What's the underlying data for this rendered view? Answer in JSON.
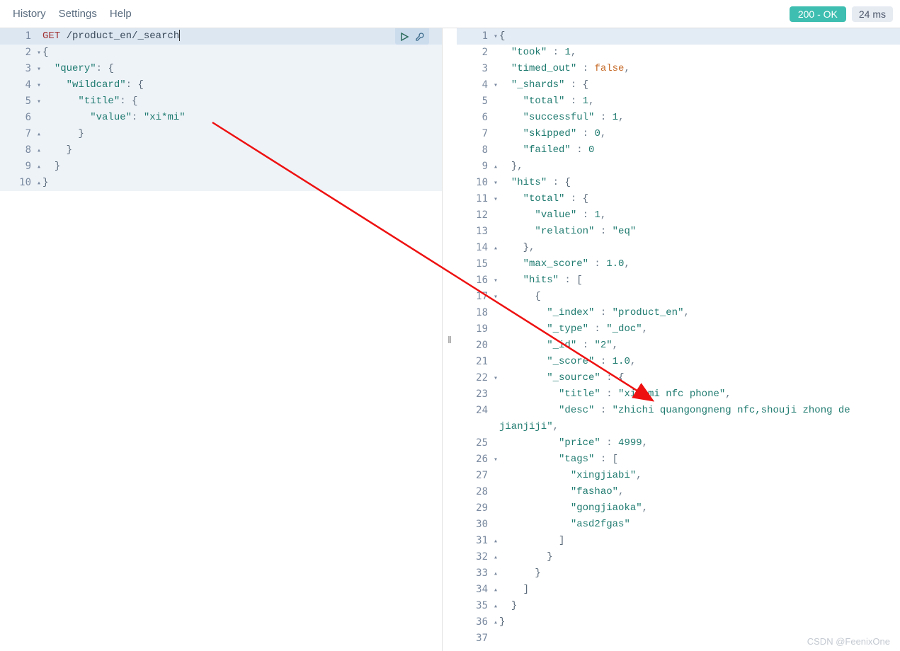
{
  "menu": {
    "history": "History",
    "settings": "Settings",
    "help": "Help"
  },
  "status": {
    "code_label": "200 - OK",
    "timing": "24 ms"
  },
  "request": {
    "method": "GET",
    "path": "/product_en/_search",
    "lines": [
      {
        "n": 1,
        "fold": ""
      },
      {
        "n": 2,
        "fold": "▾",
        "t": "{"
      },
      {
        "n": 3,
        "fold": "▾"
      },
      {
        "n": 4,
        "fold": "▾"
      },
      {
        "n": 5,
        "fold": "▾"
      },
      {
        "n": 6,
        "fold": ""
      },
      {
        "n": 7,
        "fold": "▴"
      },
      {
        "n": 8,
        "fold": "▴"
      },
      {
        "n": 9,
        "fold": "▴"
      },
      {
        "n": 10,
        "fold": "▴",
        "t": "}"
      }
    ],
    "keys": {
      "query": "\"query\"",
      "wildcard": "\"wildcard\"",
      "title": "\"title\"",
      "value": "\"value\""
    },
    "val_xi": "\"xi*mi\""
  },
  "response": {
    "keys": {
      "took": "\"took\"",
      "timed_out": "\"timed_out\"",
      "_shards": "\"_shards\"",
      "total": "\"total\"",
      "successful": "\"successful\"",
      "skipped": "\"skipped\"",
      "failed": "\"failed\"",
      "hits": "\"hits\"",
      "value": "\"value\"",
      "relation": "\"relation\"",
      "max_score": "\"max_score\"",
      "_index": "\"_index\"",
      "_type": "\"_type\"",
      "_id": "\"_id\"",
      "_score": "\"_score\"",
      "_source": "\"_source\"",
      "title": "\"title\"",
      "desc": "\"desc\"",
      "price": "\"price\"",
      "tags": "\"tags\""
    },
    "vals": {
      "took": "1",
      "timed_out": "false",
      "shards_total": "1",
      "successful": "1",
      "skipped": "0",
      "failed": "0",
      "hits_total_value": "1",
      "relation": "\"eq\"",
      "max_score": "1.0",
      "_index": "\"product_en\"",
      "_type": "\"_doc\"",
      "_id": "\"2\"",
      "_score": "1.0",
      "title": "\"xiaomi nfc phone\"",
      "desc": "\"zhichi quangongneng nfc,shouji zhong de jianjiji\"",
      "price": "4999",
      "tags": [
        "\"xingjiabi\"",
        "\"fashao\"",
        "\"gongjiaoka\"",
        "\"asd2fgas\""
      ]
    }
  },
  "watermark": "CSDN @FeenixOne"
}
